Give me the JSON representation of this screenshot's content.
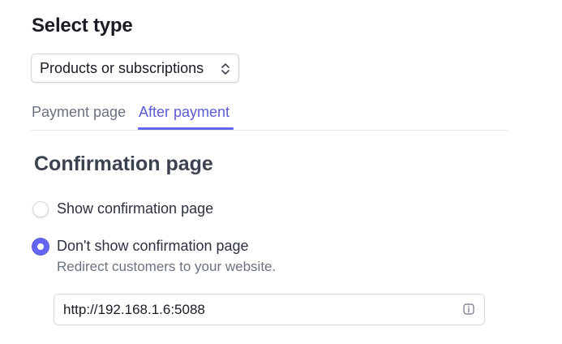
{
  "header": {
    "title": "Select type"
  },
  "type_select": {
    "value": "Products or subscriptions",
    "icon": "chevron-up-down-icon"
  },
  "tabs": [
    {
      "label": "Payment page",
      "active": false
    },
    {
      "label": "After payment",
      "active": true
    }
  ],
  "confirmation": {
    "title": "Confirmation page",
    "options": [
      {
        "label": "Show confirmation page",
        "selected": false
      },
      {
        "label": "Don't show confirmation page",
        "selected": true,
        "description": "Redirect customers to your website."
      }
    ],
    "redirect_url": {
      "value": "http://192.168.1.6:5088",
      "icon": "info-icon"
    }
  },
  "colors": {
    "accent": "#6366f1",
    "accent_text": "#5b5bd6",
    "muted_text": "#6b7280",
    "border": "#d7dbe1"
  }
}
